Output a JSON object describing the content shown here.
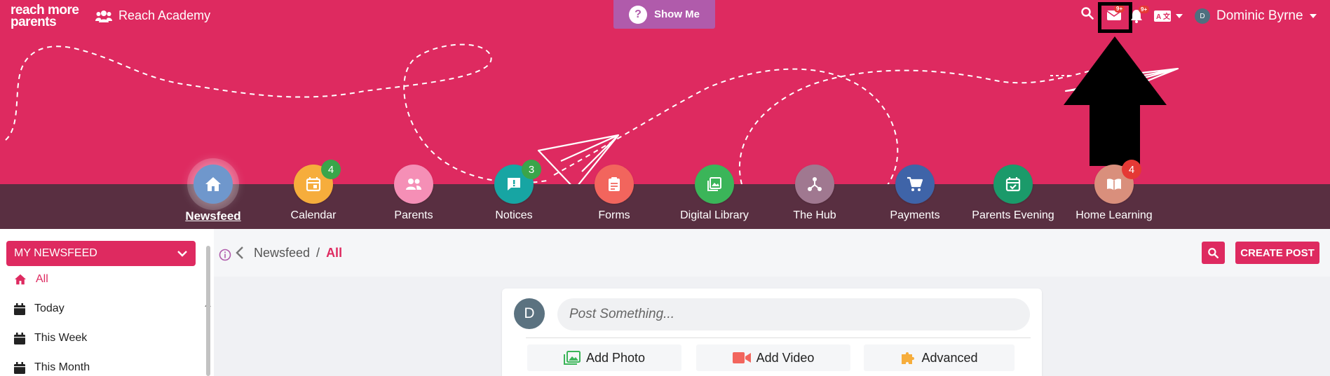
{
  "brand": {
    "logo_line1": "reach more",
    "logo_line2": "parents",
    "school_name": "Reach Academy"
  },
  "header": {
    "show_me_label": "Show Me",
    "messages_badge": "9+",
    "notifications_badge": "9+",
    "user_initial": "D",
    "user_name": "Dominic Byrne"
  },
  "nav": {
    "items": [
      {
        "label": "Newsfeed",
        "icon": "home-icon",
        "color": "#6f97cc",
        "badge": ""
      },
      {
        "label": "Calendar",
        "icon": "calendar-icon",
        "color": "#f6ad3c",
        "badge": "4"
      },
      {
        "label": "Parents",
        "icon": "people-icon",
        "color": "#f58fb6",
        "badge": ""
      },
      {
        "label": "Notices",
        "icon": "notice-icon",
        "color": "#17a5a3",
        "badge": "3"
      },
      {
        "label": "Forms",
        "icon": "form-icon",
        "color": "#f2655d",
        "badge": ""
      },
      {
        "label": "Digital Library",
        "icon": "image-icon",
        "color": "#3bb559",
        "badge": ""
      },
      {
        "label": "The Hub",
        "icon": "hub-icon",
        "color": "#a07890",
        "badge": ""
      },
      {
        "label": "Payments",
        "icon": "cart-icon",
        "color": "#3f64a8",
        "badge": ""
      },
      {
        "label": "Parents Evening",
        "icon": "calendar-check-icon",
        "color": "#1b9a6a",
        "badge": ""
      },
      {
        "label": "Home Learning",
        "icon": "book-icon",
        "color": "#d98f7c",
        "badge": "4"
      }
    ]
  },
  "sidebar": {
    "header": "MY NEWSFEED",
    "items": [
      {
        "label": "All",
        "active": true
      },
      {
        "label": "Today",
        "active": false
      },
      {
        "label": "This Week",
        "active": false
      },
      {
        "label": "This Month",
        "active": false
      }
    ]
  },
  "breadcrumb": {
    "root": "Newsfeed",
    "sep": "/",
    "current": "All"
  },
  "toolbar": {
    "create_post_label": "CREATE POST"
  },
  "composer": {
    "avatar_initial": "D",
    "placeholder": "Post Something...",
    "add_photo": "Add Photo",
    "add_video": "Add Video",
    "advanced": "Advanced"
  },
  "colors": {
    "brand": "#de2a60",
    "nav_strip": "#592f41"
  }
}
